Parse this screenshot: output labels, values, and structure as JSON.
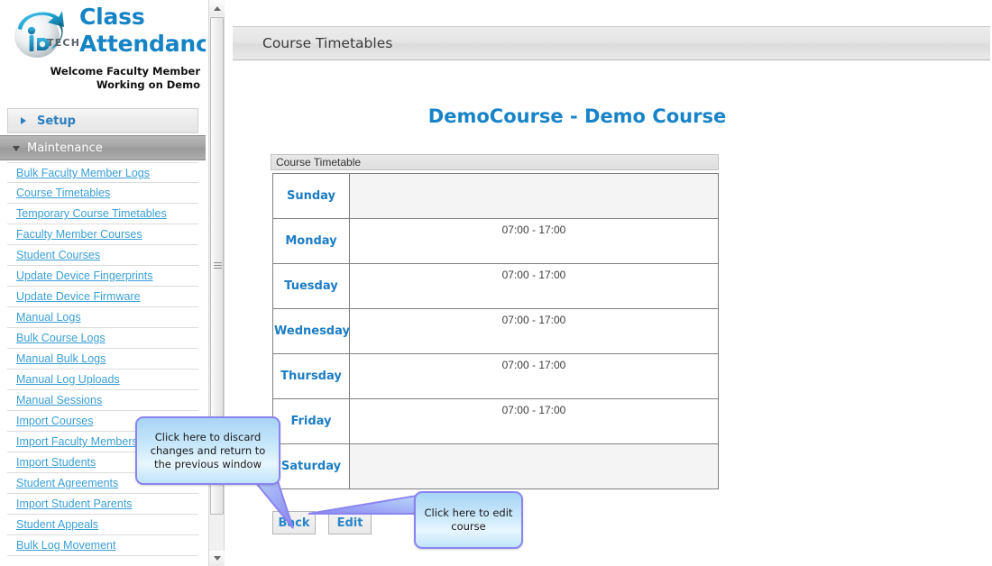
{
  "brand": {
    "line1": "Class",
    "line2": "Attendance",
    "logo_icon": "globe-swoosh-logo",
    "logo_wordmark": "TECH",
    "welcome_line1": "Welcome Faculty Member",
    "welcome_line2": "Working on Demo"
  },
  "sidebar": {
    "sections": [
      {
        "label": "Setup",
        "expanded": false,
        "icon": "chevron-right-icon"
      },
      {
        "label": "Maintenance",
        "expanded": true,
        "icon": "chevron-down-icon"
      }
    ],
    "menu_items": [
      "Bulk Faculty Member Logs",
      "Course Timetables",
      "Temporary Course Timetables",
      "Faculty Member Courses",
      "Student Courses",
      "Update Device Fingerprints",
      "Update Device Firmware",
      "Manual Logs",
      "Bulk Course Logs",
      "Manual Bulk Logs",
      "Manual Log Uploads",
      "Manual Sessions",
      "Import Courses",
      "Import Faculty Members",
      "Import Students",
      "Student Agreements",
      "Import Student Parents",
      "Student Appeals",
      "Bulk Log Movement"
    ],
    "scrollbar": {
      "up_icon": "scroll-up-arrow-icon",
      "down_icon": "scroll-down-arrow-icon",
      "thumb_grip_icon": "scrollbar-grip-icon"
    }
  },
  "header": {
    "title": "Course Timetables"
  },
  "main": {
    "course_title": "DemoCourse - Demo Course",
    "table_caption": "Course Timetable",
    "timetable": [
      {
        "day": "Sunday",
        "slots": ""
      },
      {
        "day": "Monday",
        "slots": "07:00 - 17:00"
      },
      {
        "day": "Tuesday",
        "slots": "07:00 - 17:00"
      },
      {
        "day": "Wednesday",
        "slots": "07:00 - 17:00"
      },
      {
        "day": "Thursday",
        "slots": "07:00 - 17:00"
      },
      {
        "day": "Friday",
        "slots": "07:00 - 17:00"
      },
      {
        "day": "Saturday",
        "slots": ""
      }
    ],
    "buttons": {
      "back": "Back",
      "edit": "Edit"
    }
  },
  "callouts": {
    "back_hint": "Click here to discard changes and return to the previous window",
    "edit_hint": "Click here to edit course"
  },
  "colors": {
    "brand_blue": "#1583c4",
    "link_blue": "#3a9fd6",
    "day_blue": "#1c7dc4",
    "callout_border": "#8a84f0",
    "callout_fill": "#cbe9fb"
  }
}
